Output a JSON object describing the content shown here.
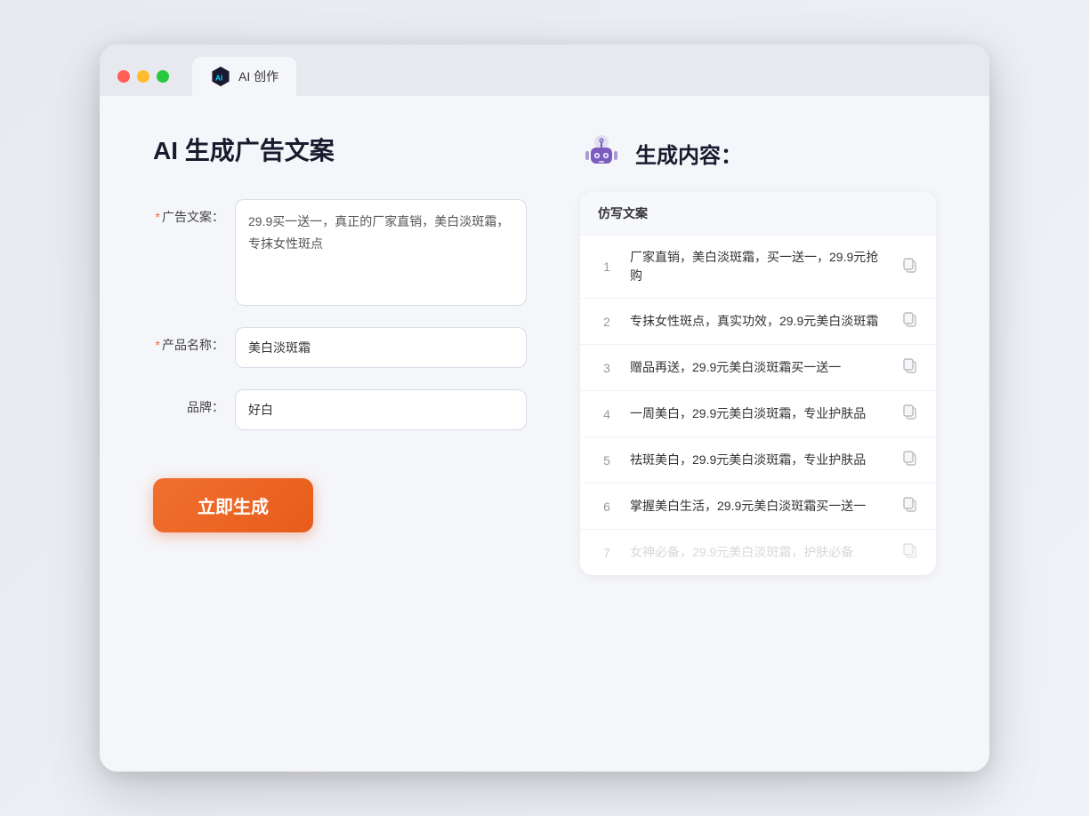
{
  "browser": {
    "tab_label": "AI 创作",
    "traffic_lights": [
      "#ff5f57",
      "#febc2e",
      "#28c840"
    ]
  },
  "left_panel": {
    "title": "AI 生成广告文案",
    "form": {
      "ad_copy_label": "广告文案：",
      "ad_copy_required": true,
      "ad_copy_value": "29.9买一送一，真正的厂家直销，美白淡斑霜，专抹女性斑点",
      "product_name_label": "产品名称：",
      "product_name_required": true,
      "product_name_value": "美白淡斑霜",
      "brand_label": "品牌：",
      "brand_required": false,
      "brand_value": "好白"
    },
    "generate_button": "立即生成"
  },
  "right_panel": {
    "title": "生成内容：",
    "table_header": "仿写文案",
    "results": [
      {
        "id": 1,
        "text": "厂家直销，美白淡斑霜，买一送一，29.9元抢购",
        "faded": false
      },
      {
        "id": 2,
        "text": "专抹女性斑点，真实功效，29.9元美白淡斑霜",
        "faded": false
      },
      {
        "id": 3,
        "text": "赠品再送，29.9元美白淡斑霜买一送一",
        "faded": false
      },
      {
        "id": 4,
        "text": "一周美白，29.9元美白淡斑霜，专业护肤品",
        "faded": false
      },
      {
        "id": 5,
        "text": "祛斑美白，29.9元美白淡斑霜，专业护肤品",
        "faded": false
      },
      {
        "id": 6,
        "text": "掌握美白生活，29.9元美白淡斑霜买一送一",
        "faded": false
      },
      {
        "id": 7,
        "text": "女神必备，29.9元美白淡斑霜，护肤必备",
        "faded": true
      }
    ]
  }
}
